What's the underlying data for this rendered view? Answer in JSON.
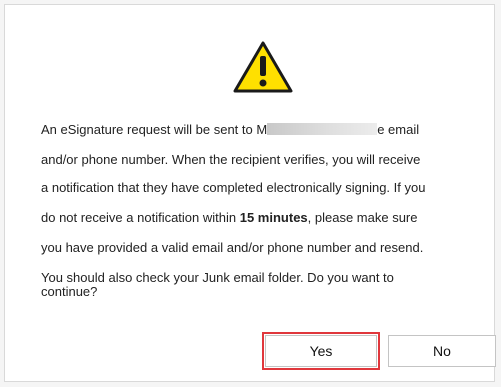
{
  "dialog": {
    "icon": "warning-triangle-icon",
    "message": {
      "line1_a": "An eSignature request will be sent to ",
      "line1_visible_char": "M",
      "line1_b": "e email",
      "line2": "and/or phone number. When the recipient verifies, you will receive",
      "line3": "a notification that they have completed electronically signing. If you",
      "line4_a": "do not receive a notification within ",
      "line4_bold": "15 minutes",
      "line4_b": ", please make sure",
      "line5": "you have provided a valid email and/or phone number and resend.",
      "line6": "You should also check your Junk email folder. Do you want to",
      "line7": "continue?"
    },
    "buttons": {
      "yes_label": "Yes",
      "no_label": "No"
    },
    "colors": {
      "icon_fill": "#FFE000",
      "highlight": "#E0373C"
    }
  }
}
